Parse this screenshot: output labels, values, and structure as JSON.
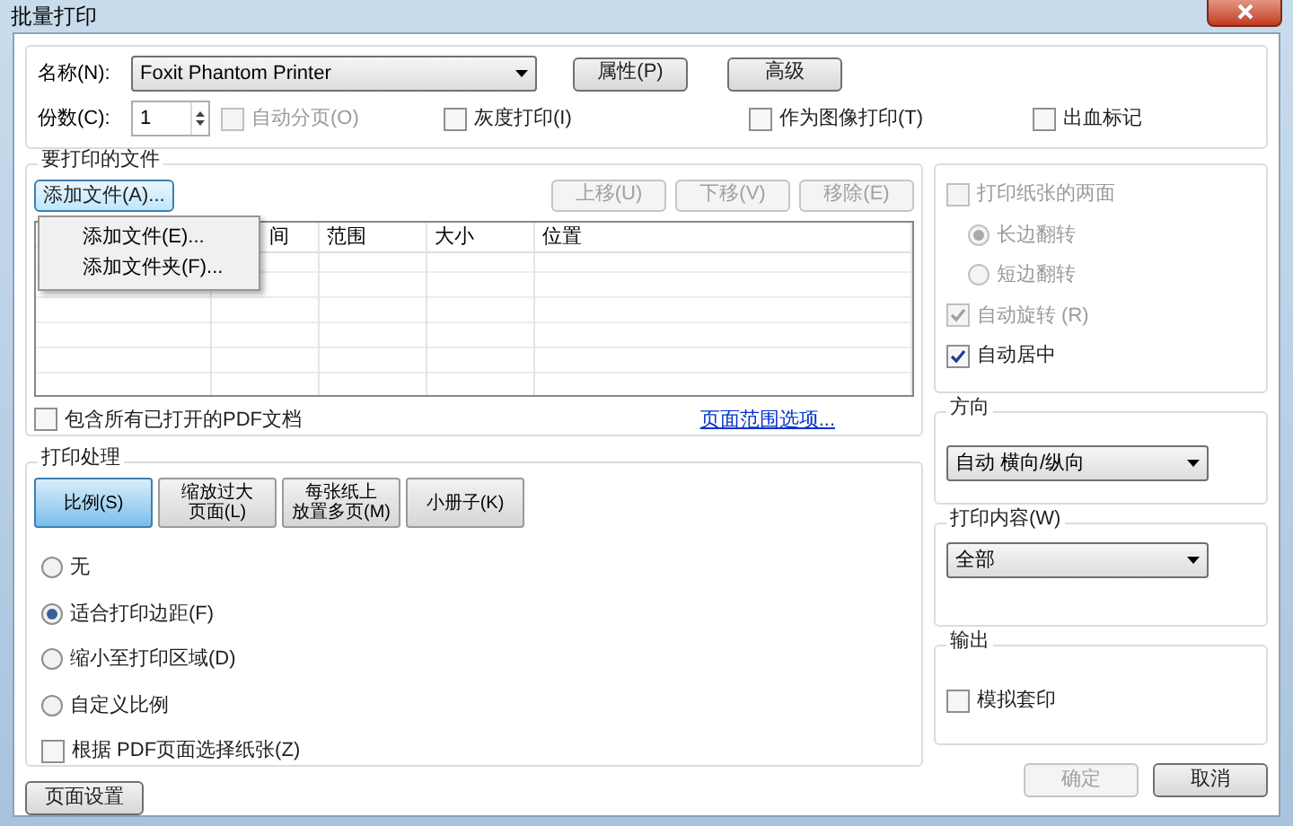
{
  "window": {
    "title": "批量打印"
  },
  "printer": {
    "name_label": "名称(N):",
    "name_value": "Foxit Phantom Printer",
    "properties_button": "属性(P)",
    "advanced_button": "高级",
    "copies_label": "份数(C):",
    "copies_value": "1",
    "options": [
      {
        "label": "自动分页(O)",
        "checked": false,
        "disabled": true
      },
      {
        "label": "灰度打印(I)",
        "checked": false,
        "disabled": false
      },
      {
        "label": "作为图像打印(T)",
        "checked": false,
        "disabled": false
      },
      {
        "label": "出血标记",
        "checked": false,
        "disabled": false
      }
    ]
  },
  "files": {
    "title": "要打印的文件",
    "add_button": "添加文件(A)...",
    "actions": [
      {
        "label": "上移(U)",
        "disabled": true
      },
      {
        "label": "下移(V)",
        "disabled": true
      },
      {
        "label": "移除(E)",
        "disabled": true
      }
    ],
    "menu": [
      {
        "label": "添加文件(E)..."
      },
      {
        "label": "添加文件夹(F)..."
      }
    ],
    "columns": [
      {
        "label": "间"
      },
      {
        "label": "范围"
      },
      {
        "label": "大小"
      },
      {
        "label": "位置"
      }
    ],
    "include_open": {
      "label": "包含所有已打开的PDF文档",
      "checked": false
    },
    "range_link": "页面范围选项..."
  },
  "processing": {
    "title": "打印处理",
    "tabs": [
      {
        "lines": [
          "比例(S)"
        ],
        "selected": true
      },
      {
        "lines": [
          "缩放过大",
          "页面(L)"
        ],
        "selected": false
      },
      {
        "lines": [
          "每张纸上",
          "放置多页(M)"
        ],
        "selected": false
      },
      {
        "lines": [
          "小册子(K)"
        ],
        "selected": false
      }
    ],
    "options": [
      {
        "kind": "radio",
        "label": "无",
        "selected": false
      },
      {
        "kind": "radio",
        "label": "适合打印边距(F)",
        "selected": true
      },
      {
        "kind": "radio",
        "label": "缩小至打印区域(D)",
        "selected": false
      },
      {
        "kind": "radio",
        "label": "自定义比例",
        "selected": false
      },
      {
        "kind": "checkbox",
        "label": "根据 PDF页面选择纸张(Z)",
        "selected": false
      }
    ]
  },
  "duplex": {
    "items": [
      {
        "kind": "checkbox",
        "label": "打印纸张的两面",
        "checked": false,
        "disabled": true,
        "nested": false
      },
      {
        "kind": "radio",
        "label": "长边翻转",
        "checked": true,
        "disabled": true,
        "nested": true
      },
      {
        "kind": "radio",
        "label": "短边翻转",
        "checked": false,
        "disabled": true,
        "nested": true
      },
      {
        "kind": "checkbox",
        "label": "自动旋转 (R)",
        "checked": true,
        "disabled": true,
        "nested": false
      },
      {
        "kind": "checkbox",
        "label": "自动居中",
        "checked": true,
        "disabled": false,
        "nested": false
      }
    ]
  },
  "orientation": {
    "title": "方向",
    "value": "自动 横向/纵向"
  },
  "print_content": {
    "title": "打印内容(W)",
    "value": "全部"
  },
  "output": {
    "title": "输出",
    "simulate": {
      "label": "模拟套印",
      "checked": false
    }
  },
  "page_setup_button": "页面设置",
  "buttons": [
    {
      "label": "确定",
      "disabled": true
    },
    {
      "label": "取消",
      "disabled": false
    }
  ]
}
